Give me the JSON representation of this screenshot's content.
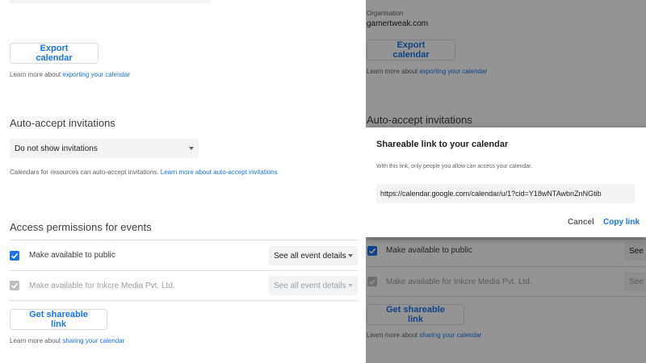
{
  "left": {
    "export": {
      "button_label": "Export calendar",
      "help_prefix": "Learn more about ",
      "help_link": "exporting your calendar"
    },
    "auto_accept": {
      "title": "Auto-accept invitations",
      "selected": "Do not show invitations",
      "help_text": "Calendars for resources can auto-accept invitations. ",
      "help_link": "Learn more about auto-accept invitations"
    },
    "access": {
      "title": "Access permissions for events",
      "rows": [
        {
          "label": "Make available to public",
          "checked": true,
          "enabled": true,
          "select": "See all event details"
        },
        {
          "label": "Make available for Inkcre Media Pvt. Ltd.",
          "checked": true,
          "enabled": false,
          "select": "See all event details"
        }
      ],
      "share_button": "Get shareable link",
      "help_prefix": "Learn more about ",
      "help_link": "sharing your calendar"
    }
  },
  "right": {
    "organisation_label": "Organisation",
    "organisation_value": "gamertweak.com",
    "export_button": "Export calendar",
    "export_help_prefix": "Learn more about ",
    "export_help_link": "exporting your calendar",
    "auto_accept_title": "Auto-accept invitations",
    "rows": [
      {
        "label": "Make available to public",
        "select": "See"
      },
      {
        "label": "Make available for Inkcre Media Pvt. Ltd.",
        "select": "See"
      }
    ],
    "share_button": "Get shareable link",
    "share_help_prefix": "Learn more about ",
    "share_help_link": "sharing your calendar",
    "dialog": {
      "title": "Shareable link to your calendar",
      "description": "With this link, only people you allow can access your calendar.",
      "link_value": "https://calendar.google.com/calendar/u/1?cid=Y18wNTAwbnZnNGtib",
      "cancel_label": "Cancel",
      "copy_label": "Copy link"
    }
  },
  "colors": {
    "accent": "#1a73e8",
    "field_bg": "#f1f3f4",
    "divider": "#e0e0e0"
  }
}
